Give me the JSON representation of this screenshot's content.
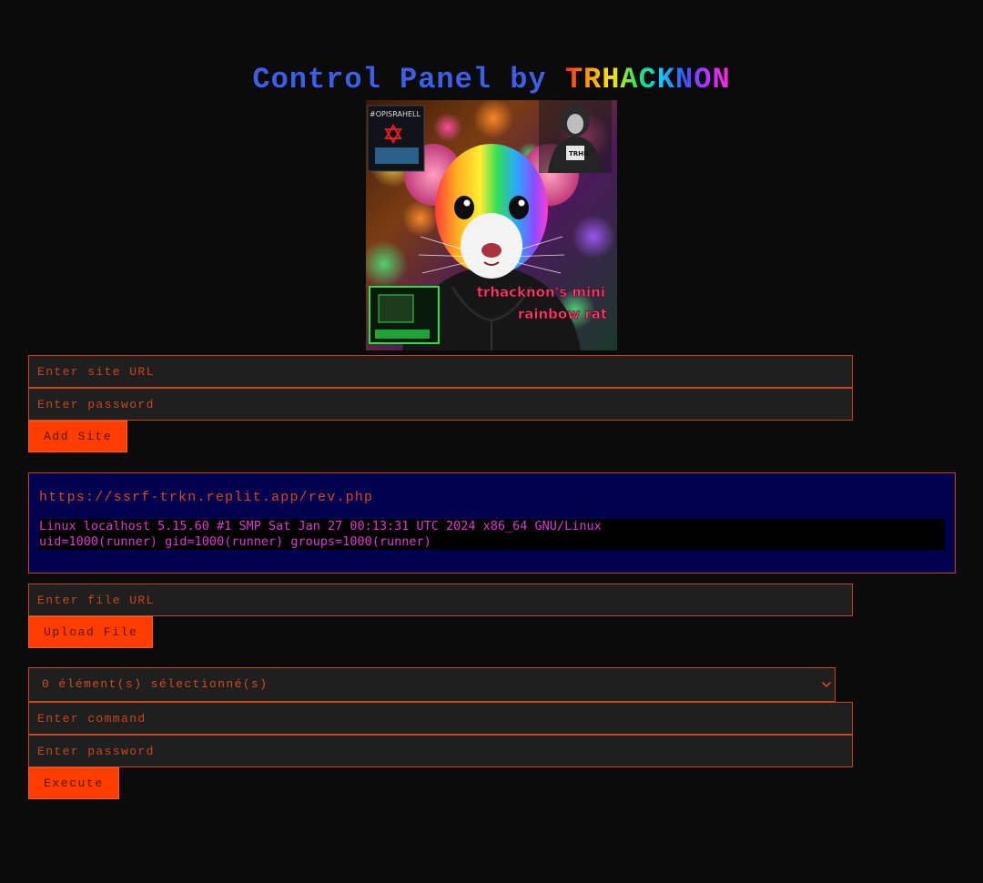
{
  "header": {
    "title_prefix": "Control Panel by ",
    "title_brand": "TRHACKNON"
  },
  "hero": {
    "caption_line1": "trhacknon's mini",
    "caption_line2": "rainbow rat",
    "sticker_text": "#OPISRAHELL",
    "badge_text": "TRHN"
  },
  "add_site": {
    "url_placeholder": "Enter site URL",
    "password_placeholder": "Enter password",
    "button_label": "Add Site"
  },
  "result": {
    "url": "https://ssrf-trkn.replit.app/rev.php",
    "output_line1": "Linux localhost 5.15.60 #1 SMP Sat Jan 27 00:13:31 UTC 2024 x86_64 GNU/Linux",
    "output_line2": "uid=1000(runner) gid=1000(runner) groups=1000(runner)"
  },
  "upload": {
    "file_url_placeholder": "Enter file URL",
    "button_label": "Upload File"
  },
  "command": {
    "site_select_text": "0 élément(s) sélectionné(s)",
    "command_placeholder": "Enter command",
    "password_placeholder": "Enter password",
    "button_label": "Execute"
  },
  "colors": {
    "background": "#0b0b0b",
    "accent": "#ff3d00",
    "border": "#c9451c",
    "title_blue": "#3d5fe8",
    "result_bg": "#00004f",
    "output_text": "#d63bd0"
  },
  "icons": {
    "select_chevron": "chevron-down-icon"
  }
}
